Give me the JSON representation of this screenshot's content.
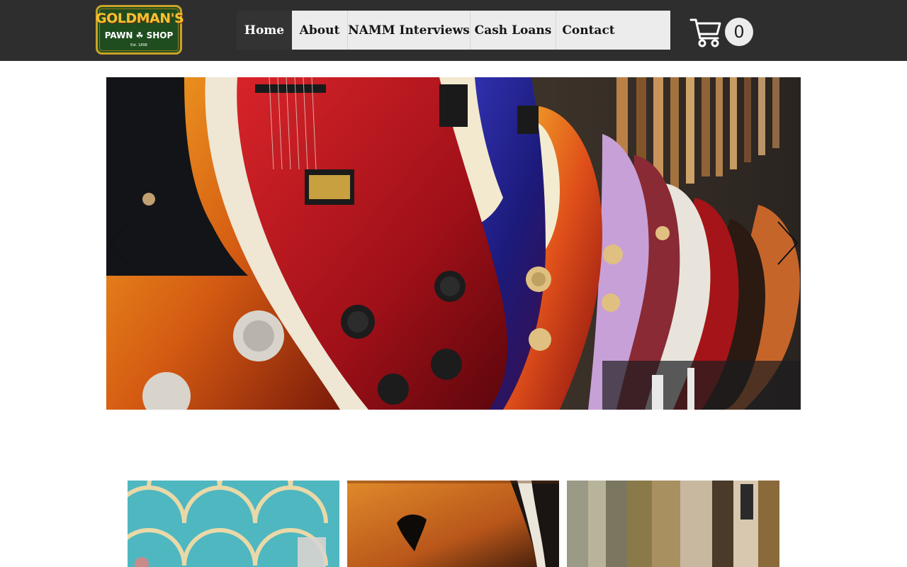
{
  "logo": {
    "top_text": "GOLDMAN'S",
    "bottom_text": "PAWN ☘ SHOP",
    "est_text": "Est. 1898"
  },
  "nav": {
    "items": [
      {
        "label": "Home",
        "active": true
      },
      {
        "label": "About",
        "active": false
      },
      {
        "label": "NAMM Interviews",
        "active": false
      },
      {
        "label": "Cash Loans",
        "active": false
      },
      {
        "label": "Contact",
        "active": false
      }
    ]
  },
  "cart": {
    "count": "0",
    "icon": "cart-icon"
  },
  "slideshow": {
    "prev_icon": "chevron-left-icon",
    "next_icon": "chevron-right-icon"
  },
  "colors": {
    "header_bg": "#2e2e2e",
    "nav_bg": "#ececec",
    "nav_active_bg": "#333333"
  }
}
